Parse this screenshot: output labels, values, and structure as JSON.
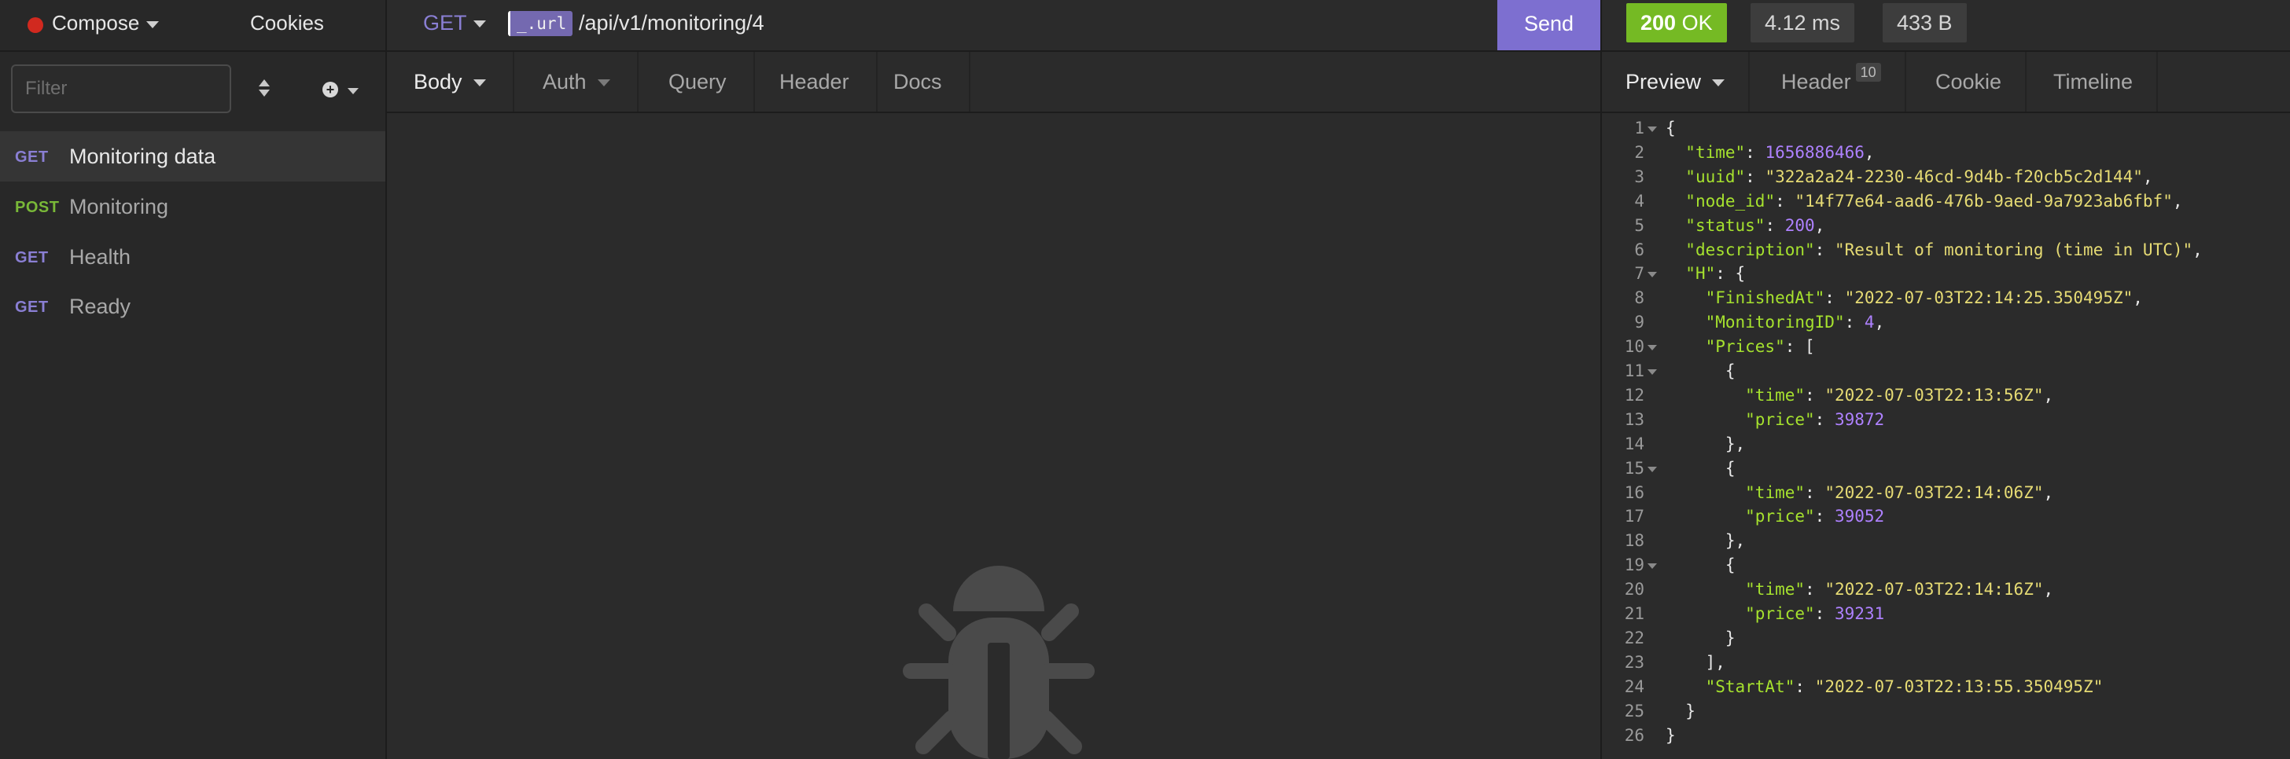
{
  "sidebar": {
    "workspace": "Compose",
    "cookies": "Cookies",
    "filter_placeholder": "Filter",
    "requests": [
      {
        "method": "GET",
        "name": "Monitoring data"
      },
      {
        "method": "POST",
        "name": "Monitoring"
      },
      {
        "method": "GET",
        "name": "Health"
      },
      {
        "method": "GET",
        "name": "Ready"
      }
    ]
  },
  "request": {
    "method": "GET",
    "url_var": "_.url",
    "url_path": "/api/v1/monitoring/4",
    "send": "Send",
    "tabs": [
      "Body",
      "Auth",
      "Query",
      "Header",
      "Docs"
    ]
  },
  "response": {
    "status_code": "200",
    "status_text": "OK",
    "time": "4.12 ms",
    "size": "433 B",
    "tabs": {
      "preview": "Preview",
      "header": "Header",
      "header_count": "10",
      "cookie": "Cookie",
      "timeline": "Timeline"
    },
    "body_lines": [
      "{",
      "  \"time\": 1656886466,",
      "  \"uuid\": \"322a2a24-2230-46cd-9d4b-f20cb5c2d144\",",
      "  \"node_id\": \"14f77e64-aad6-476b-9aed-9a7923ab6fbf\",",
      "  \"status\": 200,",
      "  \"description\": \"Result of monitoring (time in UTC)\",",
      "  \"H\": {",
      "    \"FinishedAt\": \"2022-07-03T22:14:25.350495Z\",",
      "    \"MonitoringID\": 4,",
      "    \"Prices\": [",
      "      {",
      "        \"time\": \"2022-07-03T22:13:56Z\",",
      "        \"price\": 39872",
      "      },",
      "      {",
      "        \"time\": \"2022-07-03T22:14:06Z\",",
      "        \"price\": 39052",
      "      },",
      "      {",
      "        \"time\": \"2022-07-03T22:14:16Z\",",
      "        \"price\": 39231",
      "      }",
      "    ],",
      "    \"StartAt\": \"2022-07-03T22:13:55.350495Z\"",
      "  }",
      "}"
    ],
    "fold_lines": [
      1,
      7,
      10,
      11,
      15,
      19
    ]
  },
  "colors": {
    "accent": "#7d6fd0",
    "status_ok": "#75ba24",
    "method_get": "#8a7fd4",
    "method_post": "#79b838",
    "json_key": "#a6e22e",
    "json_string": "#e6db74",
    "json_number": "#ae81ff"
  },
  "icons": {
    "workspace": "red-dot-icon",
    "sort": "sort-icon",
    "add": "plus-circle-icon",
    "empty_body": "bug-icon"
  }
}
